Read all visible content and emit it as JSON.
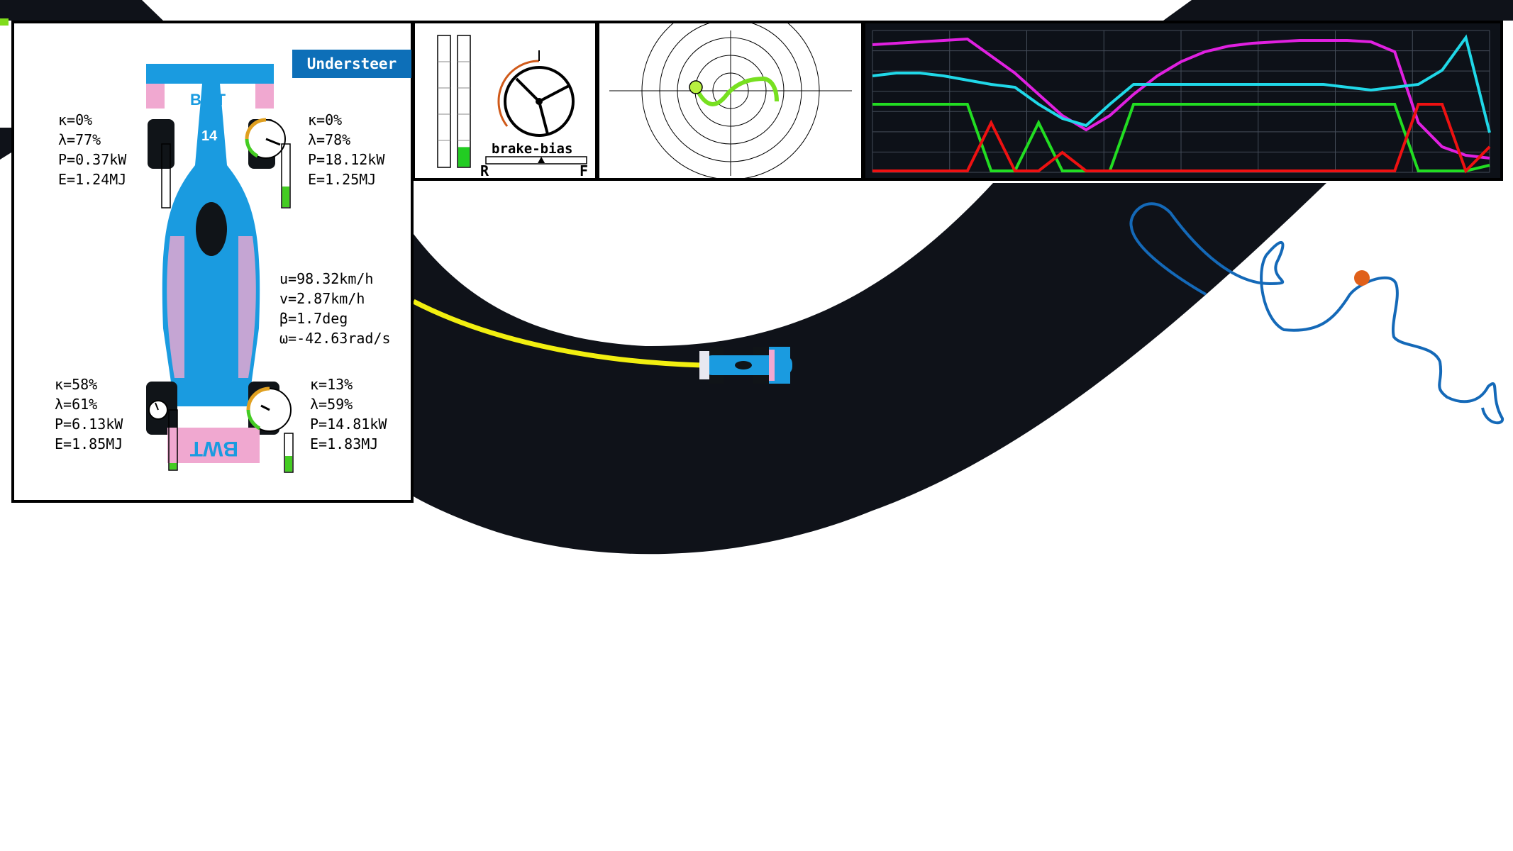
{
  "status": {
    "balance_label": "Understeer",
    "balance_color": "#0d6fb8"
  },
  "car": {
    "number": "14",
    "livery_text": "BWT",
    "livery_colors": {
      "body": "#1a9be0",
      "accent": "#f0a8d0",
      "dark": "#101418"
    }
  },
  "wheels": {
    "front_left": {
      "kappa": "κ=0%",
      "lambda": "λ=77%",
      "power": "P=0.37kW",
      "energy": "E=1.24MJ",
      "temperature_fraction": 0.0
    },
    "front_right": {
      "kappa": "κ=0%",
      "lambda": "λ=78%",
      "power": "P=18.12kW",
      "energy": "E=1.25MJ",
      "temperature_fraction": 0.3
    },
    "rear_left": {
      "kappa": "κ=58%",
      "lambda": "λ=61%",
      "power": "P=6.13kW",
      "energy": "E=1.85MJ",
      "temperature_fraction": 0.08
    },
    "rear_right": {
      "kappa": "κ=13%",
      "lambda": "λ=59%",
      "power": "P=14.81kW",
      "energy": "E=1.83MJ",
      "temperature_fraction": 0.25
    }
  },
  "vehicle_state": {
    "u": "u=98.32km/h",
    "v": "v=2.87km/h",
    "beta": "β=1.7deg",
    "omega": "ω=-42.63rad/s"
  },
  "pedals": {
    "throttle_fraction": 0.0,
    "brake_fraction": 0.15,
    "brake_color": "#22cc22",
    "steering_icon": "steering-wheel-icon",
    "brake_bias_label": "brake-bias",
    "bias_rear_label": "R",
    "bias_front_label": "F",
    "brake_bias_fraction": 0.55
  },
  "telemetry": {
    "series_colors": [
      "#e020e0",
      "#20d8e8",
      "#22dd22",
      "#ee1111"
    ],
    "series": [
      {
        "values": [
          0.9,
          0.91,
          0.92,
          0.93,
          0.94,
          0.82,
          0.7,
          0.55,
          0.4,
          0.3,
          0.4,
          0.55,
          0.68,
          0.78,
          0.85,
          0.89,
          0.91,
          0.92,
          0.93,
          0.93,
          0.93,
          0.92,
          0.85,
          0.35,
          0.18,
          0.12,
          0.1
        ]
      },
      {
        "values": [
          0.68,
          0.7,
          0.7,
          0.68,
          0.65,
          0.62,
          0.6,
          0.48,
          0.38,
          0.33,
          0.48,
          0.62,
          0.62,
          0.62,
          0.62,
          0.62,
          0.62,
          0.62,
          0.62,
          0.62,
          0.6,
          0.58,
          0.6,
          0.62,
          0.72,
          0.95,
          0.28
        ]
      },
      {
        "values": [
          0.48,
          0.48,
          0.48,
          0.48,
          0.48,
          0.01,
          0.01,
          0.35,
          0.01,
          0.01,
          0.01,
          0.48,
          0.48,
          0.48,
          0.48,
          0.48,
          0.48,
          0.48,
          0.48,
          0.48,
          0.48,
          0.48,
          0.48,
          0.01,
          0.01,
          0.01,
          0.05
        ]
      },
      {
        "values": [
          0.01,
          0.01,
          0.01,
          0.01,
          0.01,
          0.35,
          0.01,
          0.01,
          0.14,
          0.01,
          0.01,
          0.01,
          0.01,
          0.01,
          0.01,
          0.01,
          0.01,
          0.01,
          0.01,
          0.01,
          0.01,
          0.01,
          0.01,
          0.48,
          0.48,
          0.01,
          0.18
        ]
      }
    ]
  },
  "track": {
    "surface_color": "#0f1219",
    "racing_line_color": "#f2ef10",
    "map_line_color": "#1469b8",
    "position_marker_color": "#e0601a"
  }
}
